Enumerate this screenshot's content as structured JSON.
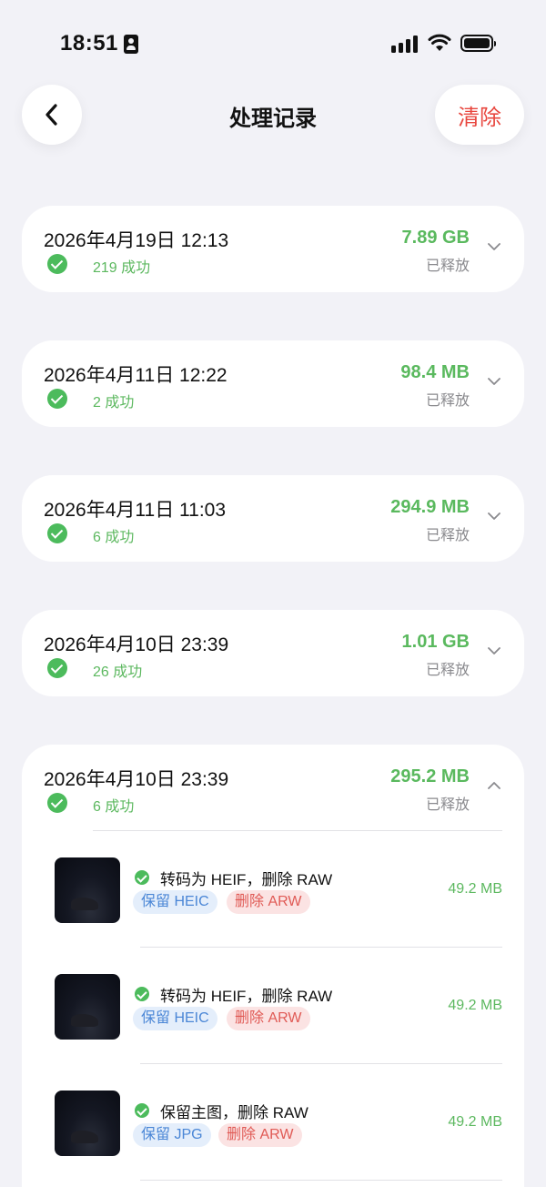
{
  "status_bar": {
    "time": "18:51"
  },
  "header": {
    "title": "处理记录",
    "clear_label": "清除"
  },
  "colors": {
    "success": "#5ab95e",
    "danger": "#e8473f",
    "keep_tag": "#4a86d6"
  },
  "records": [
    {
      "datetime": "2026年4月19日 12:13",
      "success_count": "219 成功",
      "freed": "7.89 GB",
      "freed_label": "已释放",
      "expanded": false
    },
    {
      "datetime": "2026年4月11日 12:22",
      "success_count": "2 成功",
      "freed": "98.4 MB",
      "freed_label": "已释放",
      "expanded": false
    },
    {
      "datetime": "2026年4月11日 11:03",
      "success_count": "6 成功",
      "freed": "294.9 MB",
      "freed_label": "已释放",
      "expanded": false
    },
    {
      "datetime": "2026年4月10日 23:39",
      "success_count": "26 成功",
      "freed": "1.01 GB",
      "freed_label": "已释放",
      "expanded": false
    },
    {
      "datetime": "2026年4月10日 23:39",
      "success_count": "6 成功",
      "freed": "295.2 MB",
      "freed_label": "已释放",
      "expanded": true,
      "items": [
        {
          "action": "转码为 HEIF，删除 RAW",
          "keep_tag": "保留 HEIC",
          "delete_tag": "删除 ARW",
          "size": "49.2 MB"
        },
        {
          "action": "转码为 HEIF，删除 RAW",
          "keep_tag": "保留 HEIC",
          "delete_tag": "删除 ARW",
          "size": "49.2 MB"
        },
        {
          "action": "保留主图，删除 RAW",
          "keep_tag": "保留 JPG",
          "delete_tag": "删除 ARW",
          "size": "49.2 MB"
        }
      ]
    }
  ]
}
